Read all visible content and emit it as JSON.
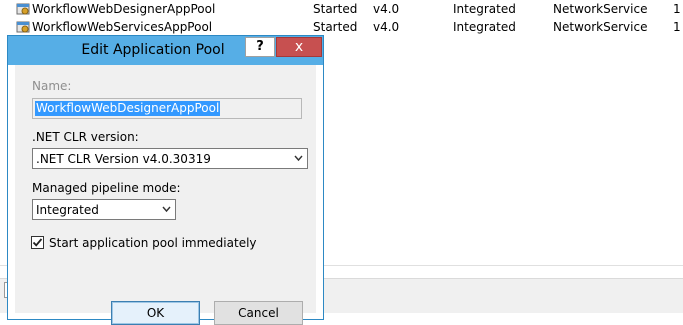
{
  "pools": [
    {
      "name": "WorkflowWebDesignerAppPool",
      "status": "Started",
      "clr": "v4.0",
      "pipeline": "Integrated",
      "identity": "NetworkService",
      "apps": "1"
    },
    {
      "name": "WorkflowWebServicesAppPool",
      "status": "Started",
      "clr": "v4.0",
      "pipeline": "Integrated",
      "identity": "NetworkService",
      "apps": "1"
    }
  ],
  "dialog": {
    "title": "Edit Application Pool",
    "help_label": "?",
    "close_label": "x",
    "name_label": "Name:",
    "name_value": "WorkflowWebDesignerAppPool",
    "clr_label": ".NET CLR version:",
    "clr_value": ".NET CLR Version v4.0.30319",
    "pipeline_label": "Managed pipeline mode:",
    "pipeline_value": "Integrated",
    "start_label": "Start application pool immediately",
    "start_checked": true,
    "ok_label": "OK",
    "cancel_label": "Cancel"
  },
  "icons": {
    "pool": "app-pool-icon",
    "dropdown": "chevron-down-icon",
    "check": "checkmark-icon"
  }
}
